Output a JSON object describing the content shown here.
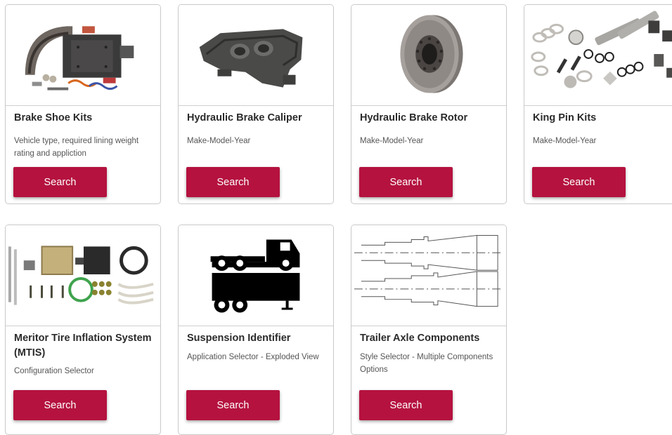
{
  "cards": [
    {
      "title": "Brake Shoe Kits",
      "desc": "Vehicle type, required lining weight rating and appliction",
      "button": "Search",
      "image": "brake-shoe-kit-image"
    },
    {
      "title": "Hydraulic Brake Caliper",
      "desc": "Make-Model-Year",
      "button": "Search",
      "image": "brake-caliper-image"
    },
    {
      "title": "Hydraulic Brake Rotor",
      "desc": "Make-Model-Year",
      "button": "Search",
      "image": "brake-rotor-image"
    },
    {
      "title": "King Pin Kits",
      "desc": "Make-Model-Year",
      "button": "Search",
      "image": "king-pin-kit-image"
    },
    {
      "title": "Meritor Tire Inflation System (MTIS)",
      "desc": "Configuration Selector",
      "button": "Search",
      "image": "tire-inflation-system-image"
    },
    {
      "title": "Suspension Identifier",
      "desc": "Application Selector - Exploded View",
      "button": "Search",
      "image": "truck-suspension-icon"
    },
    {
      "title": "Trailer Axle Components",
      "desc": "Style Selector - Multiple Components Options",
      "button": "Search",
      "image": "trailer-axle-diagram"
    }
  ],
  "colors": {
    "button": "#b5123f",
    "border": "#c9c9c9",
    "title": "#2b2b2b",
    "desc": "#555555"
  }
}
